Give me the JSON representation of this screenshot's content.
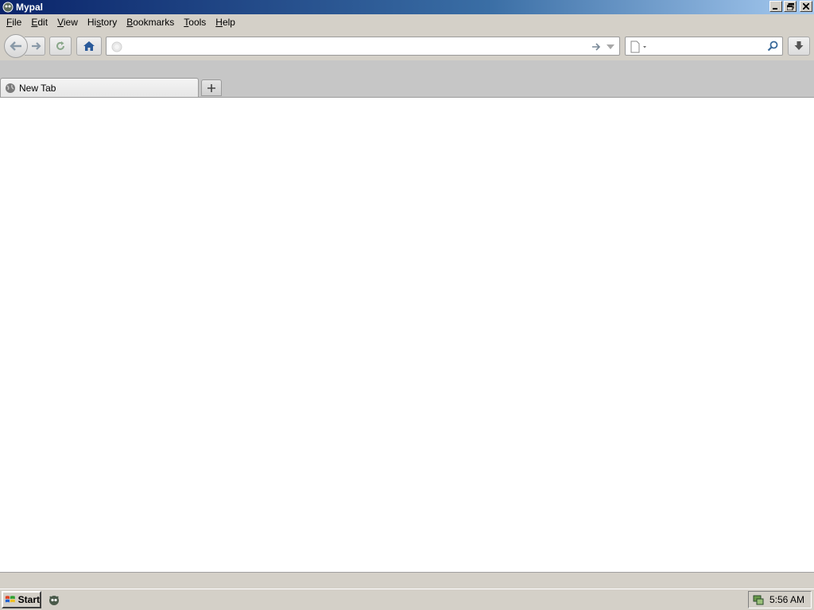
{
  "window": {
    "title": "Mypal",
    "controls": {
      "minimize": "minimize",
      "restore": "restore",
      "close": "close"
    }
  },
  "menubar": {
    "items": [
      {
        "accel": "F",
        "rest": "ile"
      },
      {
        "accel": "E",
        "rest": "dit"
      },
      {
        "accel": "V",
        "rest": "iew"
      },
      {
        "accel": "",
        "pre": "Hi",
        "accel2": "s",
        "rest": "tory"
      },
      {
        "accel": "B",
        "rest": "ookmarks"
      },
      {
        "accel": "T",
        "rest": "ools"
      },
      {
        "accel": "H",
        "rest": "elp"
      }
    ]
  },
  "navbar": {
    "url": {
      "value": "",
      "placeholder": ""
    },
    "search": {
      "value": "",
      "placeholder": ""
    }
  },
  "tabs": [
    {
      "label": "New Tab",
      "selected": true
    }
  ],
  "taskbar": {
    "start_label": "Start",
    "clock": "5:56 AM"
  },
  "colors": {
    "titlebar_start": "#0a246a",
    "titlebar_end": "#a6caf0",
    "chrome": "#d4d0c8",
    "tabstrip": "#c6c6c6",
    "home_icon": "#2a5a9a"
  }
}
